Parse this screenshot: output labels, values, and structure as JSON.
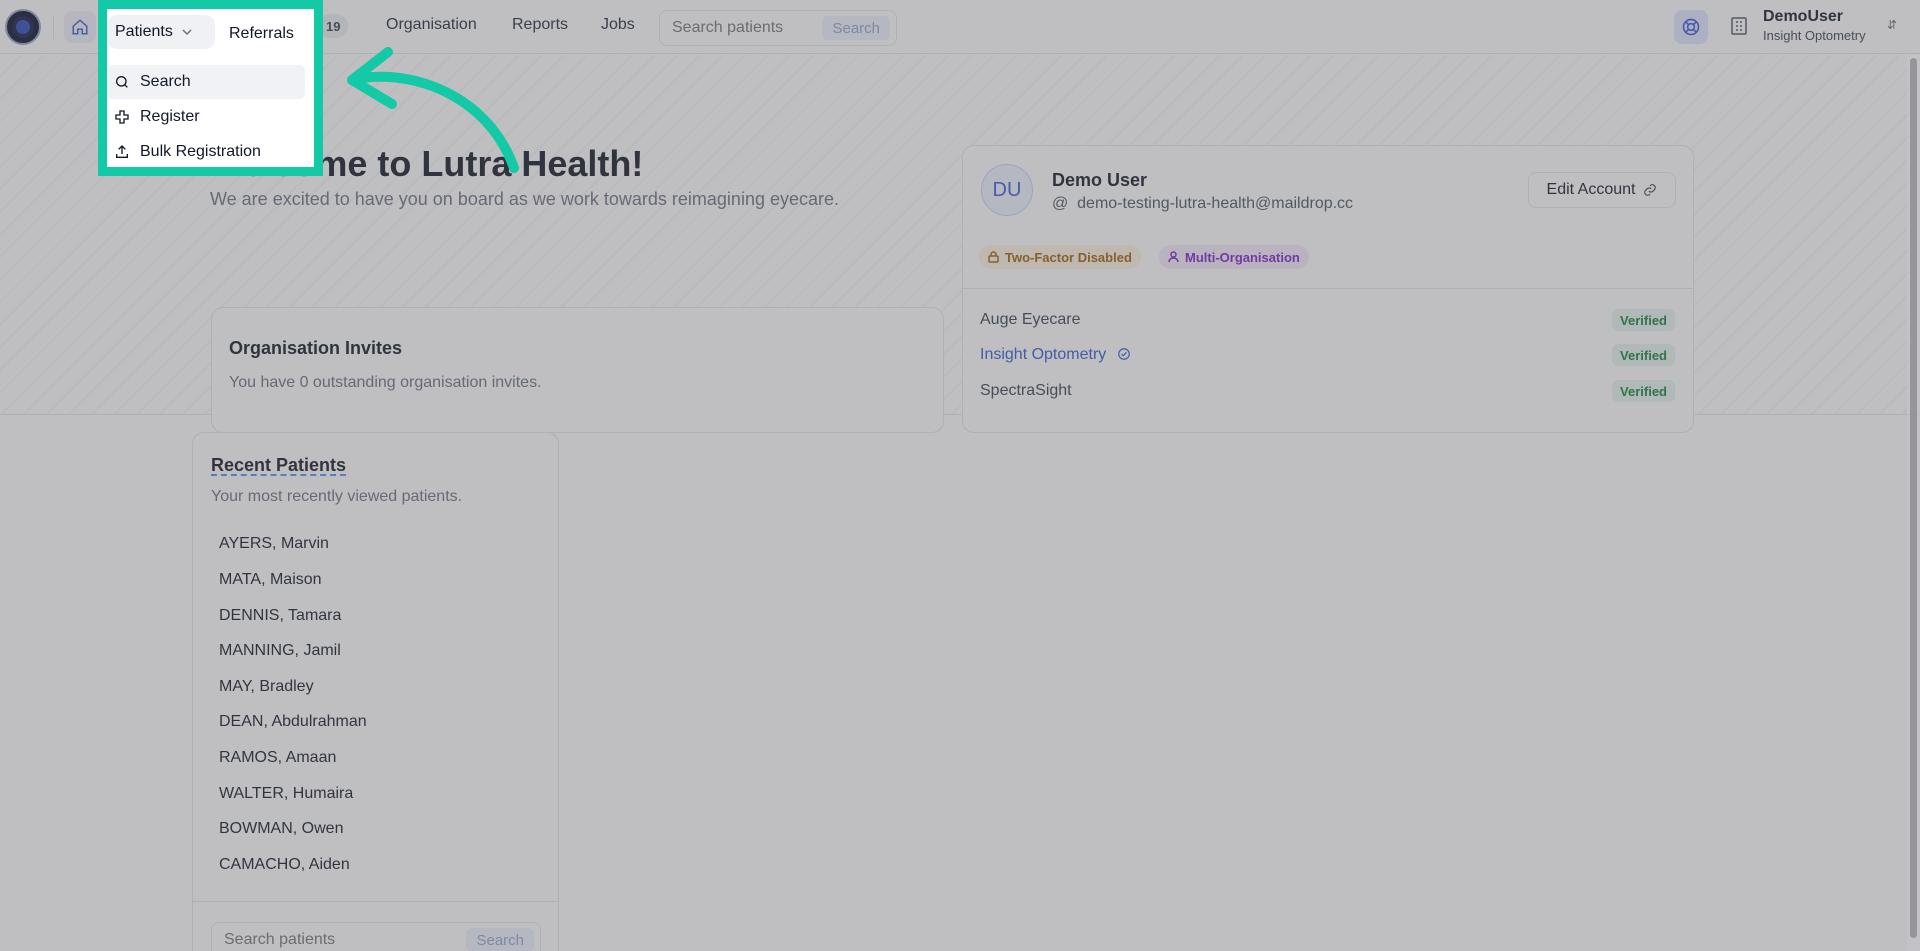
{
  "nav": {
    "patients_label": "Patients",
    "referrals_label": "Referrals",
    "referrals_count": "19",
    "organisation_label": "Organisation",
    "reports_label": "Reports",
    "jobs_label": "Jobs",
    "search_placeholder": "Search patients",
    "search_button": "Search"
  },
  "user": {
    "username": "DemoUser",
    "organisation": "Insight Optometry"
  },
  "patients_menu": {
    "items": [
      {
        "label": "Search",
        "icon": "search-icon"
      },
      {
        "label": "Register",
        "icon": "plus-icon"
      },
      {
        "label": "Bulk Registration",
        "icon": "upload-icon"
      }
    ]
  },
  "welcome": {
    "title": "Welcome to Lutra Health!",
    "subtitle": "We are excited to have you on board as we work towards reimagining eyecare."
  },
  "invites": {
    "title": "Organisation Invites",
    "text": "You have 0 outstanding organisation invites."
  },
  "account": {
    "initials": "DU",
    "name": "Demo User",
    "email": "demo-testing-lutra-health@maildrop.cc",
    "edit_label": "Edit Account",
    "badges": {
      "two_factor": "Two-Factor Disabled",
      "multi_org": "Multi-Organisation"
    },
    "organisations": [
      {
        "name": "Auge Eyecare",
        "status": "Verified",
        "active": false
      },
      {
        "name": "Insight Optometry",
        "status": "Verified",
        "active": true
      },
      {
        "name": "SpectraSight",
        "status": "Verified",
        "active": false
      }
    ]
  },
  "recent_patients": {
    "title": "Recent Patients",
    "subtitle": "Your most recently viewed patients.",
    "patients": [
      "AYERS, Marvin",
      "MATA, Maison",
      "DENNIS, Tamara",
      "MANNING, Jamil",
      "MAY, Bradley",
      "DEAN, Abdulrahman",
      "RAMOS, Amaan",
      "WALTER, Humaira",
      "BOWMAN, Owen",
      "CAMACHO, Aiden"
    ],
    "search_placeholder": "Search patients",
    "search_button": "Search"
  },
  "colors": {
    "highlight": "#14c9a6",
    "accent": "#2f5bd3",
    "verified": "#15803d"
  }
}
